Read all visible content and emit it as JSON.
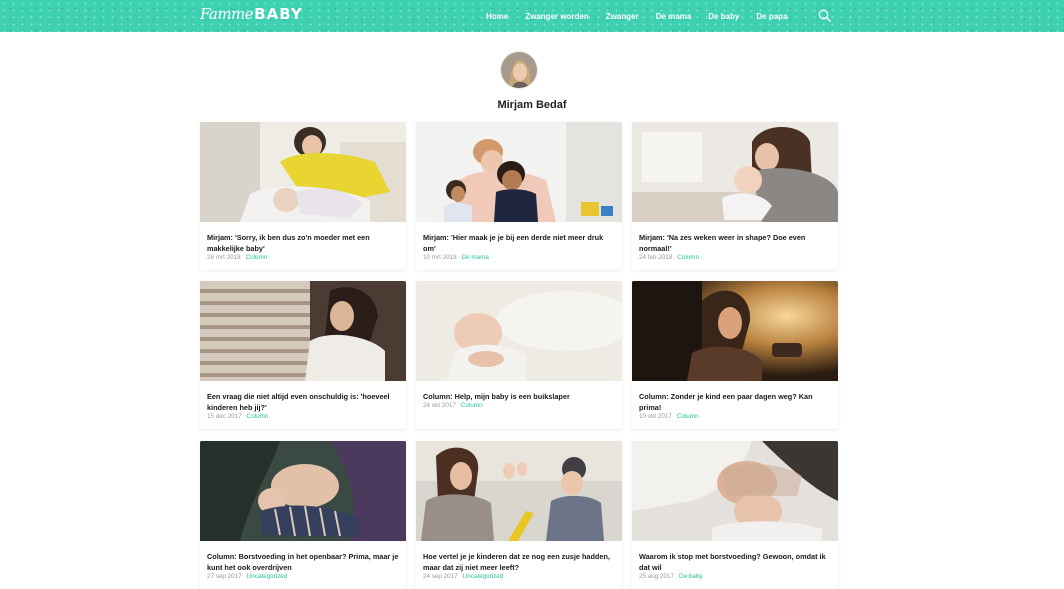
{
  "header": {
    "logo_script": "Famme",
    "logo_caps": "BABY",
    "nav": [
      "Home",
      "Zwanger worden",
      "Zwanger",
      "De mama",
      "De baby",
      "De papa"
    ],
    "search_icon": "search-icon",
    "brand_color": "#3dd0b1"
  },
  "author": {
    "name": "Mirjam Bedaf",
    "avatar_icon": "author-avatar"
  },
  "articles": [
    {
      "title": "Mirjam: 'Sorry, ik ben dus zo'n moeder met een makkelijke baby'",
      "date": "26 mrt 2018",
      "category": "Column",
      "image": "mother-yellow-sweater-baby"
    },
    {
      "title": "Mirjam: 'Hier maak je je bij een derde niet meer druk om'",
      "date": "10 mrt 2018",
      "category": "De mama",
      "image": "mother-two-kids-playing"
    },
    {
      "title": "Mirjam: 'Na zes weken weer in shape? Doe even normaal!'",
      "date": "24 feb 2018",
      "category": "Column",
      "image": "mother-kissing-baby"
    },
    {
      "title": "Een vraag die niet altijd even onschuldig is: 'hoeveel kinderen heb jij?'",
      "date": "15 dec 2017",
      "category": "Column",
      "image": "woman-by-window-blinds"
    },
    {
      "title": "Column: Help, mijn baby is een buikslaper",
      "date": "24 okt 2017",
      "category": "Column",
      "image": "sleeping-baby"
    },
    {
      "title": "Column: Zonder je kind een paar dagen weg? Kan prima!",
      "date": "10 okt 2017",
      "category": "Column",
      "image": "woman-in-car-sunlight"
    },
    {
      "title": "Column: Borstvoeding in het openbaar? Prima, maar je kunt het ook overdrijven",
      "date": "27 sep 2017",
      "category": "Uncategorized",
      "image": "breastfeeding-striped-baby"
    },
    {
      "title": "Hoe vertel je je kinderen dat ze nog een zusje hadden, maar dat zij niet meer leeft?",
      "date": "24 sep 2017",
      "category": "Uncategorized",
      "image": "mother-child-high-five"
    },
    {
      "title": "Waarom ik stop met borstvoeding? Gewoon, omdat ik dat wil",
      "date": "25 aug 2017",
      "category": "De baby",
      "image": "breastfeeding-in-bed"
    }
  ]
}
